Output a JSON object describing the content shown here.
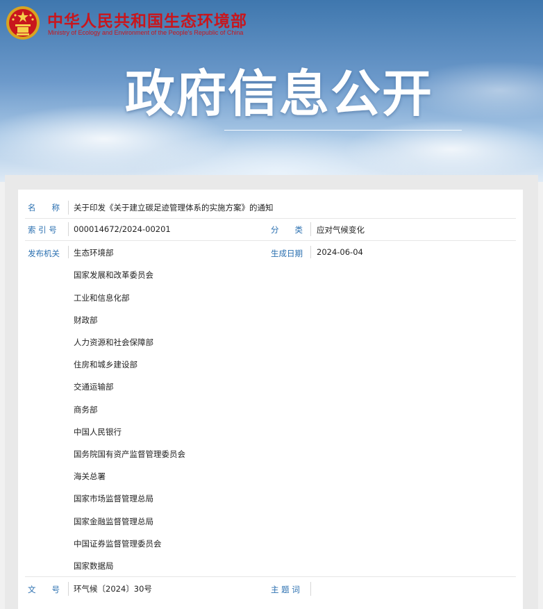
{
  "header": {
    "ministry_cn": "中华人民共和国生态环境部",
    "ministry_en": "Ministry of Ecology and Environment of the People's Republic of China",
    "hero_title": "政府信息公开"
  },
  "colors": {
    "ministry_red": "#c8161d",
    "label_blue": "#2a6fb0"
  },
  "doc": {
    "name_label": "名　　称",
    "name_value": "关于印发《关于建立碳足迹管理体系的实施方案》的通知",
    "index_label": "索 引 号",
    "index_value": "000014672/2024-00201",
    "category_label": "分　　类",
    "category_value": "应对气候变化",
    "publisher_label": "发布机关",
    "date_label": "生成日期",
    "date_value": "2024-06-04",
    "publishers": [
      "生态环境部",
      "国家发展和改革委员会",
      "工业和信息化部",
      "财政部",
      "人力资源和社会保障部",
      "住房和城乡建设部",
      "交通运输部",
      "商务部",
      "中国人民银行",
      "国务院国有资产监督管理委员会",
      "海关总署",
      "国家市场监督管理总局",
      "国家金融监督管理总局",
      "中国证券监督管理委员会",
      "国家数据局"
    ],
    "docno_label": "文　　号",
    "docno_value": "环气候〔2024〕30号",
    "keywords_label": "主 题 词",
    "keywords_value": ""
  }
}
